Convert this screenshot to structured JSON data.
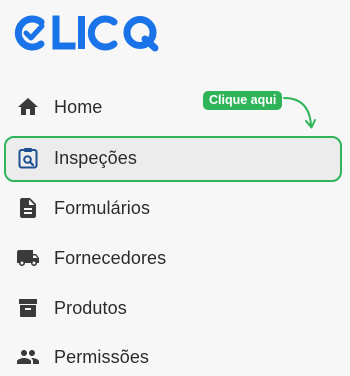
{
  "brand": {
    "logo_text": "CLICQ",
    "primary_color": "#1a73e8",
    "accent_color": "#2fb45a"
  },
  "hint": {
    "label": "Clique aqui"
  },
  "sidebar": {
    "active_index": 1,
    "items": [
      {
        "label": "Home",
        "icon": "home-icon"
      },
      {
        "label": "Inspeções",
        "icon": "clipboard-search-icon"
      },
      {
        "label": "Formulários",
        "icon": "document-icon"
      },
      {
        "label": "Fornecedores",
        "icon": "truck-icon"
      },
      {
        "label": "Produtos",
        "icon": "archive-box-icon"
      },
      {
        "label": "Permissões",
        "icon": "people-icon"
      }
    ]
  }
}
